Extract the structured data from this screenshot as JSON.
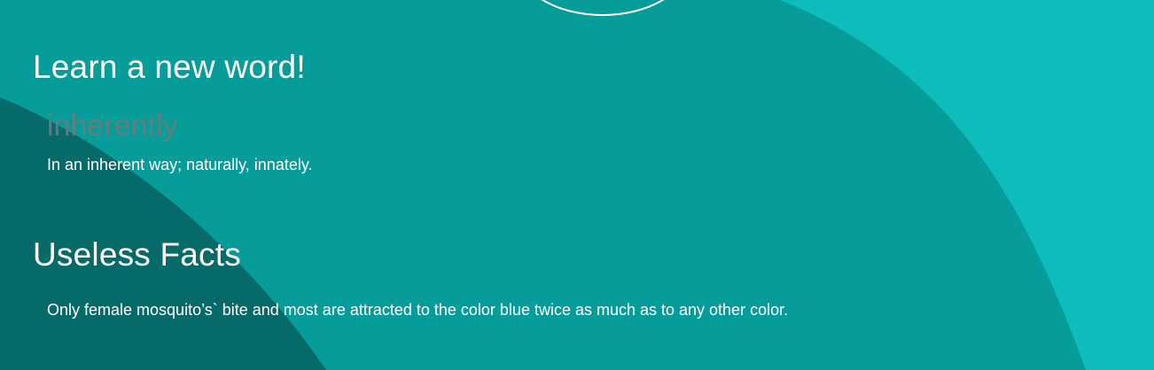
{
  "colors": {
    "background": "#069c9a",
    "accent_right": "#0dbdbb",
    "accent_left": "#056a68",
    "text": "#ffffff",
    "word_text": "#6f7b7d"
  },
  "learn_word": {
    "heading": "Learn a new word!",
    "word": "inherently",
    "definition": "In an inherent way; naturally, innately."
  },
  "useless_facts": {
    "heading": "Useless Facts",
    "fact": "Only female mosquito’s` bite and most are attracted to the color blue twice as much as to any other color."
  }
}
